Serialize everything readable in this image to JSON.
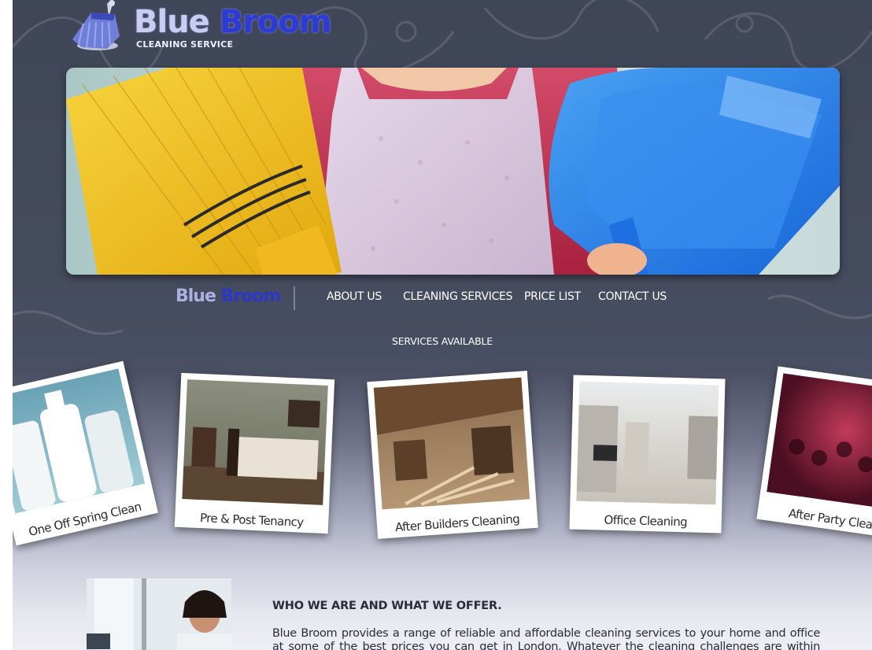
{
  "logo": {
    "word1": "Blue",
    "word2": "Broom",
    "tagline": "CLEANING SERVICE"
  },
  "nav": {
    "brand_word1": "Blue",
    "brand_word2": "Broom",
    "items": [
      {
        "label": "ABOUT US"
      },
      {
        "label": "CLEANING SERVICES"
      },
      {
        "label": "PRICE LIST"
      },
      {
        "label": "CONTACT US"
      }
    ],
    "sub_item": "SERVICES AVAILABLE"
  },
  "services": [
    {
      "caption": "One Off Spring Clean"
    },
    {
      "caption": "Pre & Post Tenancy"
    },
    {
      "caption": "After Builders Cleaning"
    },
    {
      "caption": "Office Cleaning"
    },
    {
      "caption": "After Party Clean"
    }
  ],
  "content": {
    "heading": "WHO WE ARE AND WHAT WE OFFER.",
    "body": "Blue Broom provides a range of reliable and affordable cleaning services to your home and office at some of the best prices you can get in London. Whatever the cleaning challenges are within your"
  },
  "colors": {
    "page_top": "#3f4657",
    "page_bottom": "#eeeef4",
    "brand_light": "#c9cdf3",
    "brand_blue": "#2d3bd4"
  }
}
